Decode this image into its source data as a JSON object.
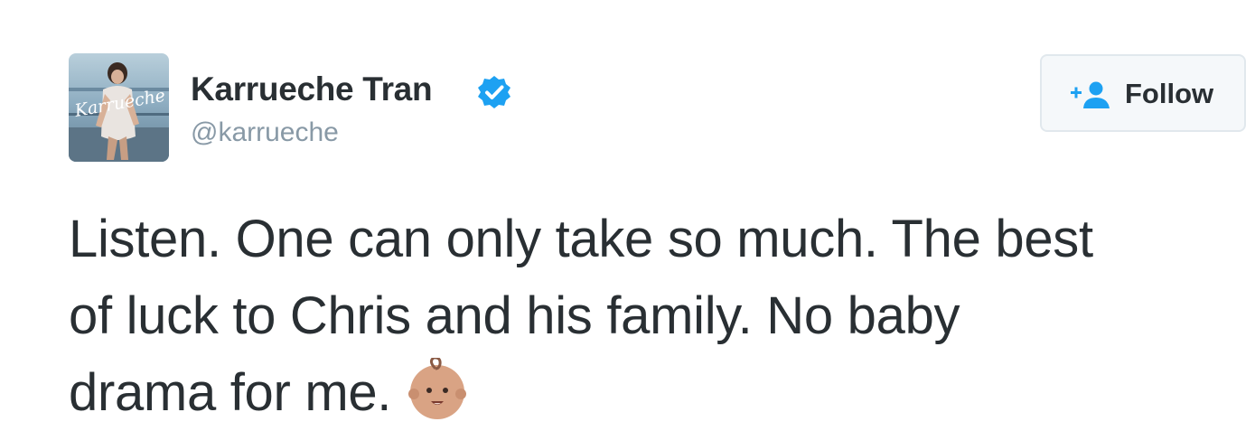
{
  "profile": {
    "display_name": "Karrueche Tran",
    "handle": "@karrueche",
    "avatar_icon": "profile-photo",
    "avatar_script_text": "Karrueche",
    "verified": true,
    "verified_icon": "verified-badge-icon"
  },
  "follow": {
    "label": "Follow",
    "icon": "add-user-icon"
  },
  "tweet": {
    "lines": [
      "Listen. One can only take so much. The best",
      "of luck to Chris and his family. No baby",
      "drama for me."
    ],
    "emoji": "baby-emoji"
  },
  "colors": {
    "text": "#292f33",
    "muted": "#8899a6",
    "verified": "#1da1f2",
    "button_bg": "#f5f8fa",
    "button_border": "#e1e8ed",
    "follow_icon": "#1da1f2"
  }
}
